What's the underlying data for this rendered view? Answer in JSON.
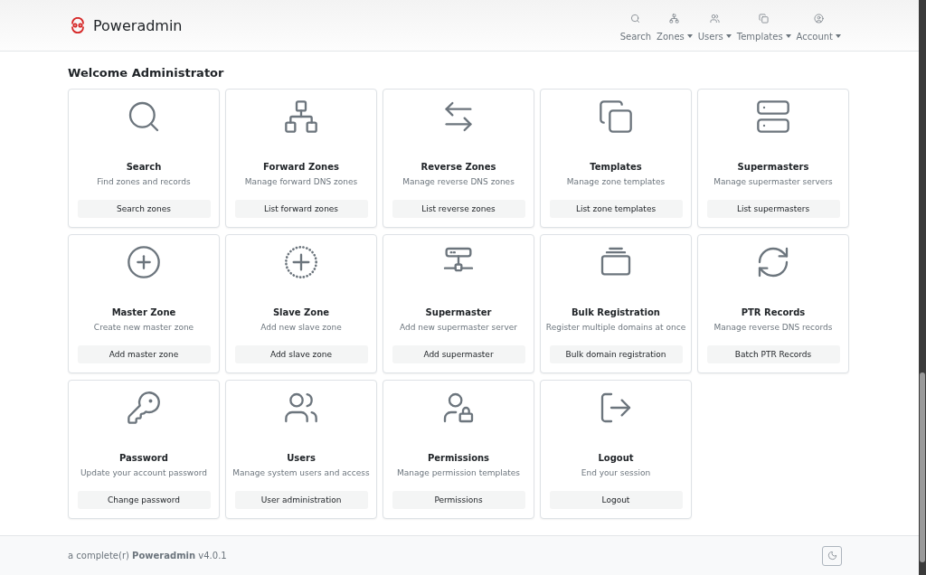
{
  "brand": {
    "name": "Poweradmin"
  },
  "nav": [
    {
      "label": "Search",
      "dropdown": false
    },
    {
      "label": "Zones",
      "dropdown": true
    },
    {
      "label": "Users",
      "dropdown": true
    },
    {
      "label": "Templates",
      "dropdown": true
    },
    {
      "label": "Account",
      "dropdown": true
    }
  ],
  "heading": "Welcome Administrator",
  "cards": [
    {
      "title": "Search",
      "description": "Find zones and records",
      "action": "Search zones"
    },
    {
      "title": "Forward Zones",
      "description": "Manage forward DNS zones",
      "action": "List forward zones"
    },
    {
      "title": "Reverse Zones",
      "description": "Manage reverse DNS zones",
      "action": "List reverse zones"
    },
    {
      "title": "Templates",
      "description": "Manage zone templates",
      "action": "List zone templates"
    },
    {
      "title": "Supermasters",
      "description": "Manage supermaster servers",
      "action": "List supermasters"
    },
    {
      "title": "Master Zone",
      "description": "Create new master zone",
      "action": "Add master zone"
    },
    {
      "title": "Slave Zone",
      "description": "Add new slave zone",
      "action": "Add slave zone"
    },
    {
      "title": "Supermaster",
      "description": "Add new supermaster server",
      "action": "Add supermaster"
    },
    {
      "title": "Bulk Registration",
      "description": "Register multiple domains at once",
      "action": "Bulk domain registration"
    },
    {
      "title": "PTR Records",
      "description": "Manage reverse DNS records",
      "action": "Batch PTR Records"
    },
    {
      "title": "Password",
      "description": "Update your account password",
      "action": "Change password"
    },
    {
      "title": "Users",
      "description": "Manage system users and access",
      "action": "User administration"
    },
    {
      "title": "Permissions",
      "description": "Manage permission templates",
      "action": "Permissions"
    },
    {
      "title": "Logout",
      "description": "End your session",
      "action": "Logout"
    }
  ],
  "footer": {
    "text": "a complete(r) **Poweradmin** v4.0.1"
  }
}
